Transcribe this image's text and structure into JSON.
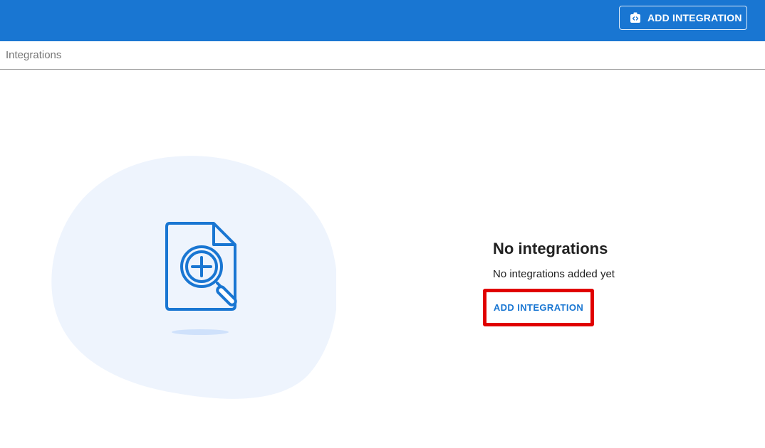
{
  "header": {
    "add_button_label": "ADD INTEGRATION",
    "add_button_icon": "extension-add-icon",
    "background_color": "#1976d2"
  },
  "breadcrumb": {
    "label": "Integrations"
  },
  "empty_state": {
    "illustration_icon": "document-search-add-icon",
    "title": "No integrations",
    "subtitle": "No integrations added yet",
    "action_label": "ADD INTEGRATION",
    "accent_color": "#1976d2",
    "highlight_color": "#e00000"
  }
}
